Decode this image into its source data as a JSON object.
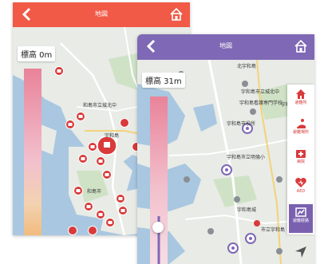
{
  "colors": {
    "header_a": "#f05a46",
    "header_b": "#7f68b5",
    "water": "#a9c7e0",
    "land": "#e8ebe6",
    "green": "#cfe2c6",
    "road": "#ffffff",
    "marker_red": "#d93a3a",
    "gradient_top": "#f0b8c6",
    "gradient_bottom": "#f3c48c"
  },
  "phone_a": {
    "header_title": "地図",
    "elevation_label": "標高 0m",
    "map_labels": [
      "宇和島",
      "和島市",
      "和島市立城北中"
    ]
  },
  "phone_b": {
    "header_title": "地図",
    "elevation_label": "標高 31m",
    "map_labels": [
      "北宇和島",
      "宇和島",
      "宇和島市立城北中",
      "宇和島市立明倫小",
      "宇和島城",
      "宇和島市役所",
      "市立宇和島",
      "宇和島看護専門学校"
    ],
    "side_buttons": [
      {
        "label": "避難所",
        "icon": "shelter-icon"
      },
      {
        "label": "避難場所",
        "icon": "evacuation-site-icon"
      },
      {
        "label": "病院",
        "icon": "hospital-icon"
      },
      {
        "label": "AED",
        "icon": "aed-icon"
      },
      {
        "label": "避難経路",
        "icon": "route-icon"
      }
    ]
  }
}
